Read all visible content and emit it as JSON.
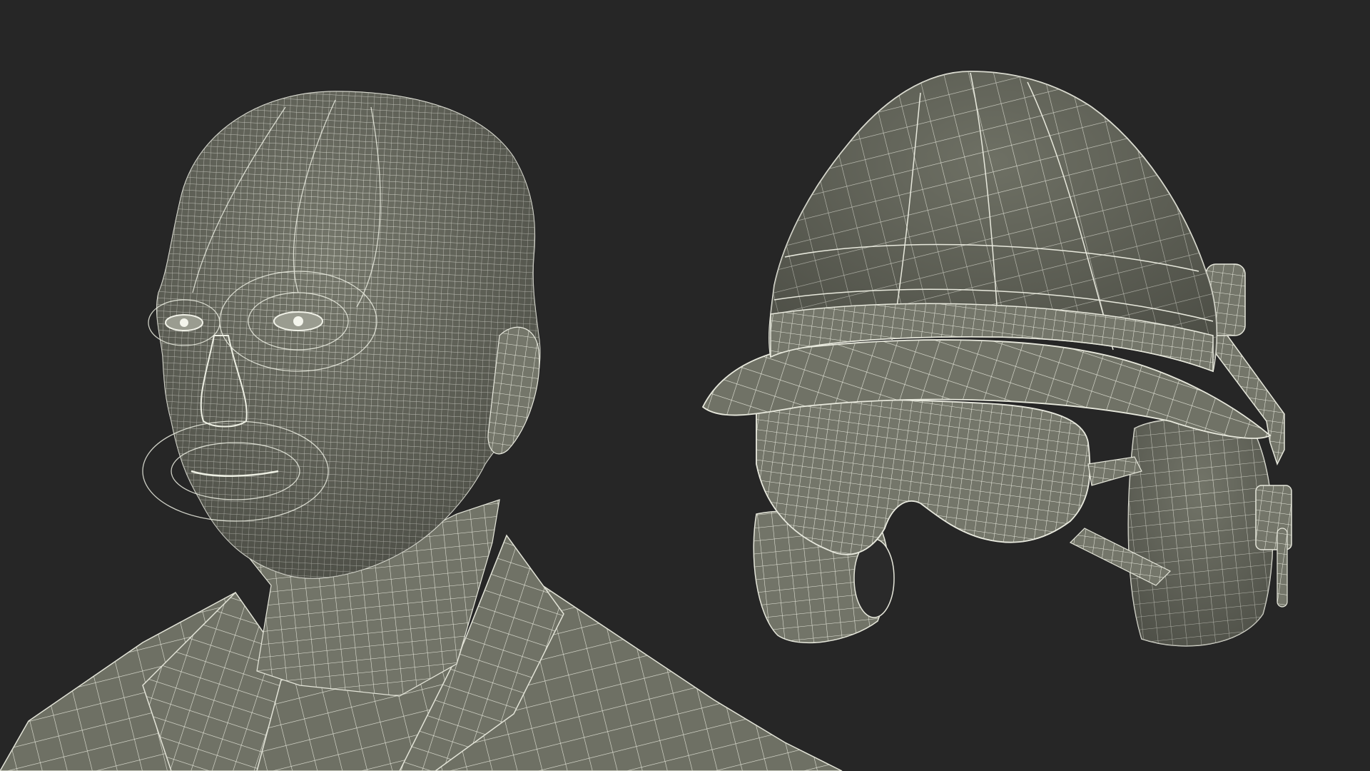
{
  "scene": {
    "background_color": "#262626",
    "mesh_fill_color": "#76786c",
    "wire_color": "#e9eadf",
    "objects": [
      "human-head-wireframe",
      "safety-helmet-wireframe"
    ]
  }
}
